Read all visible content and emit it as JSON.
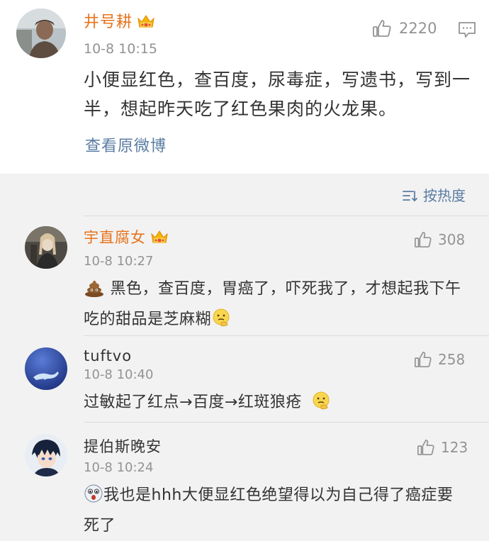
{
  "main_post": {
    "username": "井号耕",
    "timestamp": "10-8 10:15",
    "likes": "2220",
    "text": "小便显红色，查百度，尿毒症，写遗书，写到一半，想起昨天吃了红色果肉的火龙果。",
    "view_original": "查看原微博"
  },
  "sort": {
    "label": "按热度"
  },
  "comments": [
    {
      "username": "宇直腐女",
      "timestamp": "10-8 10:27",
      "likes": "308",
      "text_before": "",
      "text": "黑色，查百度，胃癌了，吓死我了，才想起我下午吃的甜品是芝麻糊"
    },
    {
      "username": "tuftvo",
      "timestamp": "10-8 10:40",
      "likes": "258",
      "text": "过敏起了红点→百度→红斑狼疮"
    },
    {
      "username": "提伯斯晚安",
      "timestamp": "10-8 10:24",
      "likes": "123",
      "text": "我也是hhh大便显红色绝望得以为自己得了癌症要死了"
    }
  ],
  "colors": {
    "vip_name": "#e8731b",
    "link": "#5a7ca3",
    "meta": "#939393",
    "text": "#333333"
  },
  "icons": {
    "like": "thumbs-up-icon",
    "reply": "comment-bubble-icon",
    "sort": "sort-lines-icon",
    "vip": "crown-badge-icon"
  }
}
